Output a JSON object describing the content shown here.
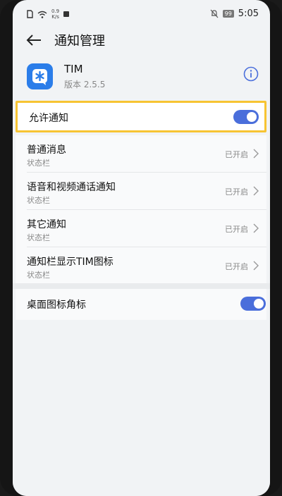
{
  "status_bar": {
    "speed_value": "0.9",
    "speed_unit": "K/s",
    "battery": "99",
    "time": "5:05"
  },
  "header": {
    "title": "通知管理"
  },
  "app": {
    "name": "TIM",
    "version": "版本 2.5.5"
  },
  "allow_notifications": {
    "label": "允许通知",
    "enabled": true
  },
  "notification_channels": [
    {
      "title": "普通消息",
      "subtitle": "状态栏",
      "status": "已开启"
    },
    {
      "title": "语音和视频通话通知",
      "subtitle": "状态栏",
      "status": "已开启"
    },
    {
      "title": "其它通知",
      "subtitle": "状态栏",
      "status": "已开启"
    },
    {
      "title": "通知栏显示TIM图标",
      "subtitle": "状态栏",
      "status": "已开启"
    }
  ],
  "desktop_badge": {
    "label": "桌面图标角标",
    "enabled": true
  },
  "colors": {
    "accent": "#4a6edb",
    "highlight": "#f7c433",
    "app_icon": "#2b7de9"
  }
}
